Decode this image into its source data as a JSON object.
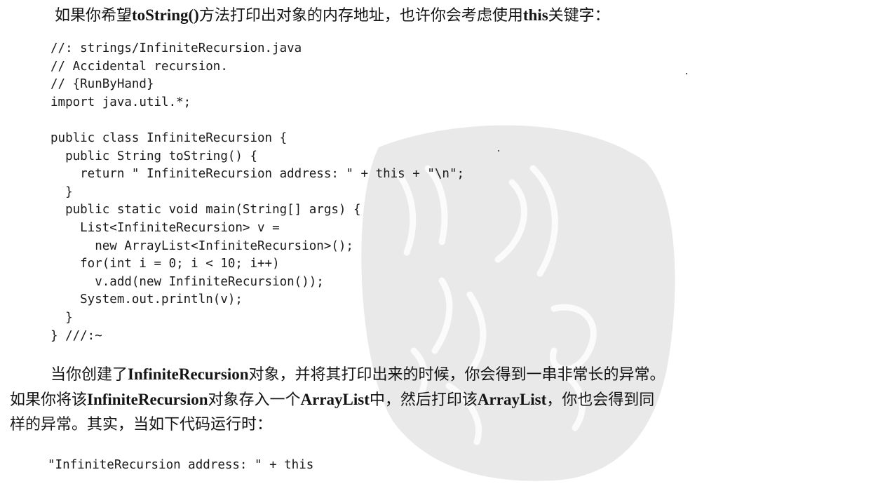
{
  "paragraph1": {
    "t1": "如果你希望",
    "b1": "toString()",
    "t2": "方法打印出对象的内存地址，也许你会考虑使用",
    "b2": "this",
    "t3": "关键字："
  },
  "code_listing": [
    "//: strings/InfiniteRecursion.java",
    "// Accidental recursion.",
    "// {RunByHand}",
    "import java.util.*;",
    "",
    "public class InfiniteRecursion {",
    "  public String toString() {",
    "    return \" InfiniteRecursion address: \" + this + \"\\n\";",
    "  }",
    "  public static void main(String[] args) {",
    "    List<InfiniteRecursion> v =",
    "      new ArrayList<InfiniteRecursion>();",
    "    for(int i = 0; i < 10; i++)",
    "      v.add(new InfiniteRecursion());",
    "    System.out.println(v);",
    "  }",
    "} ///:~"
  ],
  "paragraph2": {
    "l1_t1": "当你创建了",
    "l1_b1": "InfiniteRecursion",
    "l1_t2": "对象，并将其打印出来的时候，你会得到一串非常长的异常。",
    "l2_t1": "如果你将该",
    "l2_b1": "InfiniteRecursion",
    "l2_t2": "对象存入一个",
    "l2_b2": "ArrayList",
    "l2_t3": "中，然后打印该",
    "l2_b3": "ArrayList",
    "l2_t4": "，你也会得到同",
    "l3_t1": "样的异常。其实，当如下代码运行时："
  },
  "code_snippet": "\"InfiniteRecursion address: \" + this"
}
